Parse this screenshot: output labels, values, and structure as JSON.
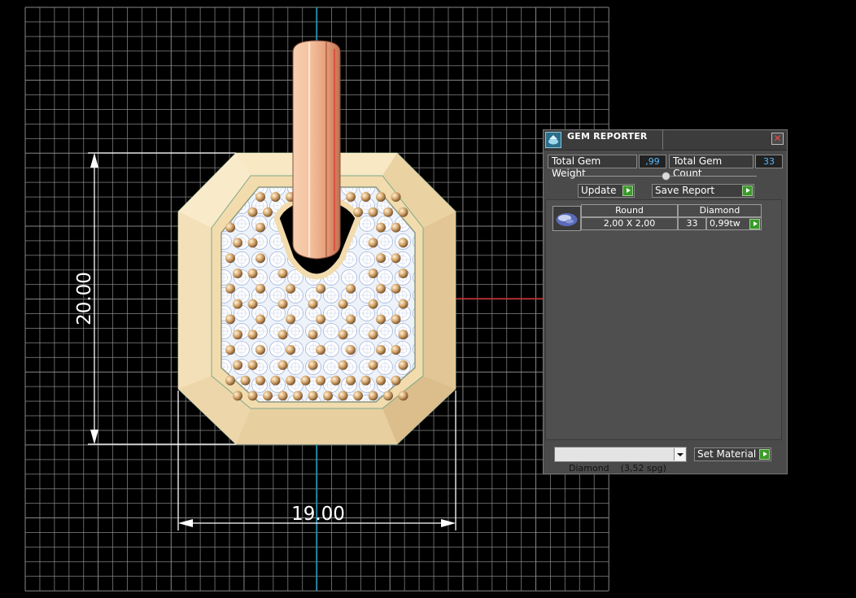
{
  "viewport": {
    "dimension_height": "20.00",
    "dimension_width": "19.00"
  },
  "gem_reporter": {
    "title": "GEM REPORTER",
    "close_symbol": "✕",
    "total_weight_label": "Total Gem Weight",
    "total_weight_value": ",99",
    "total_count_label": "Total Gem Count",
    "total_count_value": "33",
    "update_label": "Update",
    "save_report_label": "Save Report",
    "table": {
      "headers": [
        "Round",
        "Diamond"
      ],
      "rows": [
        {
          "size": "2,00 X 2,00",
          "count": "33",
          "weight": "0,99tw"
        }
      ]
    },
    "material_selected": "Diamond    (3,52 spg)",
    "set_material_label": "Set Material"
  },
  "colors": {
    "metal": "#f2dcae",
    "grid": "#8e8e8e",
    "axis_x": "#c41f1f",
    "axis_y": "#1c8fb0",
    "panel_bg": "#4a4a4a",
    "value_text": "#56b8ff",
    "button_arrow": "#3a9a2a"
  }
}
